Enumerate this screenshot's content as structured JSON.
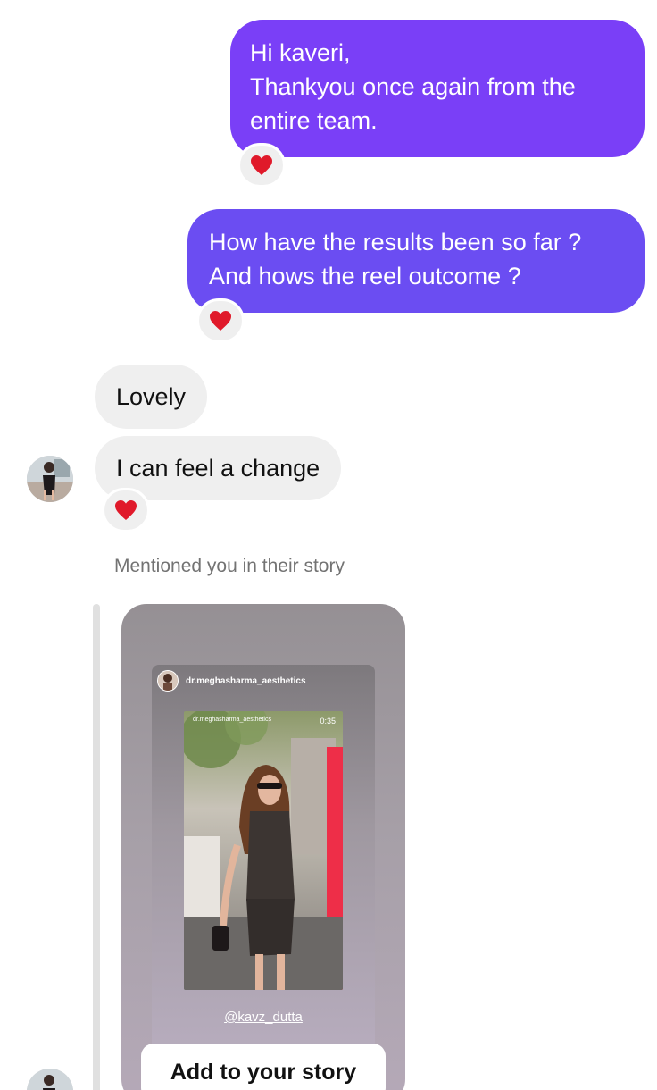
{
  "messages": {
    "sent_1": {
      "lines": [
        "Hi kaveri,",
        "Thankyou once again from the",
        "entire team."
      ],
      "reaction": "heart"
    },
    "sent_2": {
      "lines": [
        "How have the results been so far ?",
        "And hows the reel outcome ?"
      ],
      "reaction": "heart"
    },
    "received_1": {
      "text": "Lovely"
    },
    "received_2": {
      "text": "I can feel a change",
      "reaction": "heart"
    }
  },
  "story_mention": {
    "label": "Mentioned you in their story",
    "story_username": "dr.meghasharma_aesthetics",
    "photo_username": "dr.meghasharma_aesthetics",
    "photo_timer": "0:35",
    "mention_handle": "@kavz_dutta",
    "add_button_label": "Add to your story"
  },
  "colors": {
    "sent_bubble_top": "#7b3ff6",
    "sent_bubble_bottom": "#6a4ef0",
    "received_bubble": "#efefef",
    "heart": "#e0192a",
    "meta_text": "#737373"
  }
}
